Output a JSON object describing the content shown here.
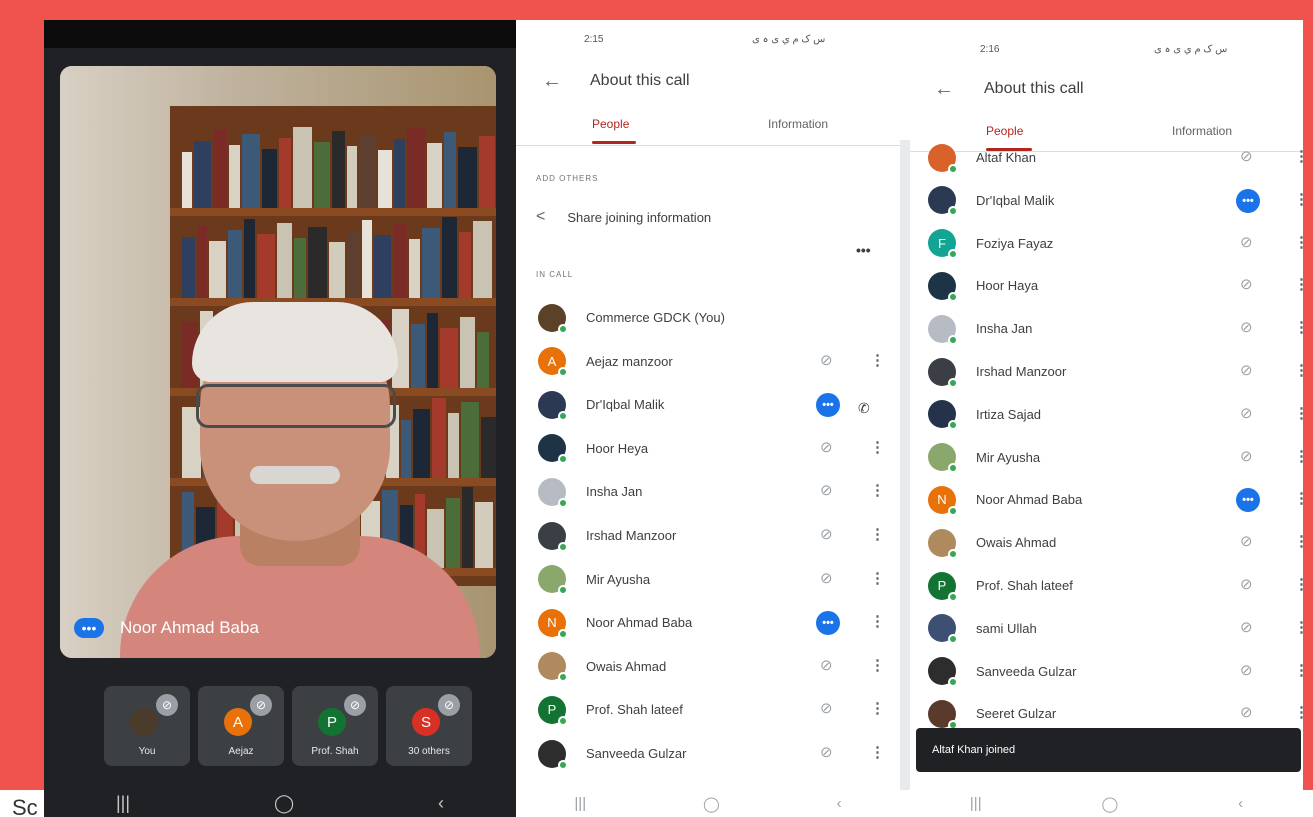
{
  "caption": "Sc",
  "left_panel": {
    "speaker_name": "Noor Ahmad Baba",
    "tiles": [
      {
        "label": "You",
        "initial": "",
        "color": "#4a3b2a"
      },
      {
        "label": "Aejaz",
        "initial": "A",
        "color": "#e8710a"
      },
      {
        "label": "Prof. Shah",
        "initial": "P",
        "color": "#137333"
      },
      {
        "label": "30 others",
        "initial": "S",
        "color": "#d93025"
      }
    ]
  },
  "middle_panel": {
    "status_time": "2:15",
    "status_icons": "س ک م ي ی ہ ی",
    "title": "About this call",
    "tabs": {
      "people": "People",
      "information": "Information"
    },
    "add_others_heading": "ADD OTHERS",
    "share_label": "Share joining information",
    "in_call_heading": "IN CALL",
    "people": [
      {
        "name": "Commerce GDCK (You)",
        "initial": "",
        "color": "#5b4128",
        "state": "none"
      },
      {
        "name": "Aejaz manzoor",
        "initial": "A",
        "color": "#e8710a",
        "state": "muted"
      },
      {
        "name": "Dr'Iqbal Malik",
        "initial": "",
        "color": "#2b3a52",
        "state": "speaking"
      },
      {
        "name": "Hoor Heya",
        "initial": "",
        "color": "#1f3347",
        "state": "muted"
      },
      {
        "name": "Insha Jan",
        "initial": "",
        "color": "#b7bcc4",
        "state": "muted"
      },
      {
        "name": "Irshad Manzoor",
        "initial": "",
        "color": "#3b3f45",
        "state": "muted"
      },
      {
        "name": "Mir Ayusha",
        "initial": "",
        "color": "#8ba86c",
        "state": "muted"
      },
      {
        "name": "Noor Ahmad Baba",
        "initial": "N",
        "color": "#e8710a",
        "state": "speaking"
      },
      {
        "name": "Owais Ahmad",
        "initial": "",
        "color": "#b08a5f",
        "state": "muted"
      },
      {
        "name": "Prof. Shah lateef",
        "initial": "P",
        "color": "#137333",
        "state": "muted"
      },
      {
        "name": "Sanveeda Gulzar",
        "initial": "",
        "color": "#2d2d2d",
        "state": "muted"
      }
    ]
  },
  "right_panel": {
    "status_time": "2:16",
    "title": "About this call",
    "tabs": {
      "people": "People",
      "information": "Information"
    },
    "people": [
      {
        "name": "Altaf Khan",
        "initial": "",
        "color": "#d9622b",
        "state": "muted"
      },
      {
        "name": "Dr'Iqbal Malik",
        "initial": "",
        "color": "#2b3a52",
        "state": "speaking"
      },
      {
        "name": "Foziya Fayaz",
        "initial": "F",
        "color": "#12a594",
        "state": "muted"
      },
      {
        "name": "Hoor Haya",
        "initial": "",
        "color": "#1f3347",
        "state": "muted"
      },
      {
        "name": "Insha Jan",
        "initial": "",
        "color": "#b7bcc4",
        "state": "muted"
      },
      {
        "name": "Irshad Manzoor",
        "initial": "",
        "color": "#3b3f45",
        "state": "muted"
      },
      {
        "name": "Irtiza Sajad",
        "initial": "",
        "color": "#24324a",
        "state": "muted"
      },
      {
        "name": "Mir Ayusha",
        "initial": "",
        "color": "#8ba86c",
        "state": "muted"
      },
      {
        "name": "Noor Ahmad Baba",
        "initial": "N",
        "color": "#e8710a",
        "state": "speaking"
      },
      {
        "name": "Owais Ahmad",
        "initial": "",
        "color": "#b08a5f",
        "state": "muted"
      },
      {
        "name": "Prof. Shah lateef",
        "initial": "P",
        "color": "#137333",
        "state": "muted"
      },
      {
        "name": "sami Ullah",
        "initial": "",
        "color": "#3d4f73",
        "state": "muted"
      },
      {
        "name": "Sanveeda Gulzar",
        "initial": "",
        "color": "#2d2d2d",
        "state": "muted"
      },
      {
        "name": "Seeret Gulzar",
        "initial": "",
        "color": "#5a3a2a",
        "state": "muted"
      }
    ],
    "snackbar": "Altaf Khan joined"
  },
  "nav_glyphs": {
    "recents": "|||",
    "home": "◯",
    "back": "‹"
  },
  "icons": {
    "mute": "mic-off-icon",
    "speaking": "speaking-dots-icon",
    "menu": "more-vert-icon"
  }
}
